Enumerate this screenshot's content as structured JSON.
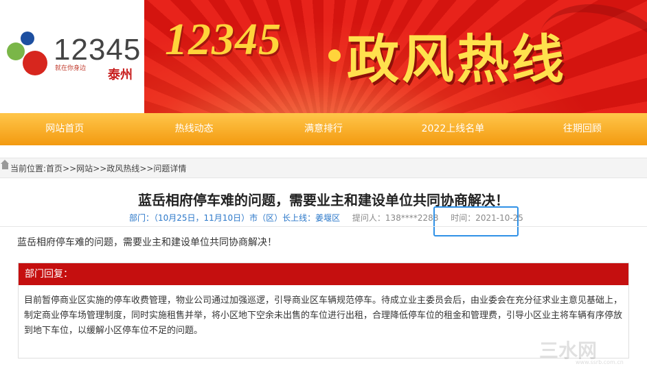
{
  "banner": {
    "logo_number": "12345",
    "logo_tagline": "就在你身边",
    "logo_city": "泰州",
    "hotline_number": "12345",
    "title": "政风热线",
    "colors": {
      "primary_red": "#e8231b",
      "gold": "#ffd43b",
      "nav_orange": "#f39a10"
    }
  },
  "nav": {
    "items": [
      {
        "label": "网站首页"
      },
      {
        "label": "热线动态"
      },
      {
        "label": "满意排行"
      },
      {
        "label": "2022上线名单"
      },
      {
        "label": "往期回顾"
      }
    ]
  },
  "breadcrumb": {
    "prefix": "当前位置:",
    "home": "首页",
    "sep": ">>",
    "level1": "网站",
    "level2": "政风热线",
    "current": "问题详情"
  },
  "article": {
    "title": "蓝岳相府停车难的问题，需要业主和建设单位共同协商解决！",
    "department": "部门：（10月25日，11月10日）市（区）长上线：姜堰区",
    "asker": "提问人：138****2288",
    "time": "时间：2021-10-25",
    "question": "蓝岳相府停车难的问题，需要业主和建设单位共同协商解决！"
  },
  "reply": {
    "heading": "部门回复：",
    "body": "目前暂停商业区实施的停车收费管理，物业公司通过加强巡逻，引导商业区车辆规范停车。待成立业主委员会后，由业委会在充分征求业主意见基础上，制定商业停车场管理制度，同时实施租售并举，将小区地下空余未出售的车位进行出租，合理降低停车位的租金和管理费，引导小区业主将车辆有序停放到地下车位，以缓解小区停车位不足的问题。"
  },
  "watermark": {
    "text": "三水网",
    "url": "www.ssrb.com.cn"
  }
}
